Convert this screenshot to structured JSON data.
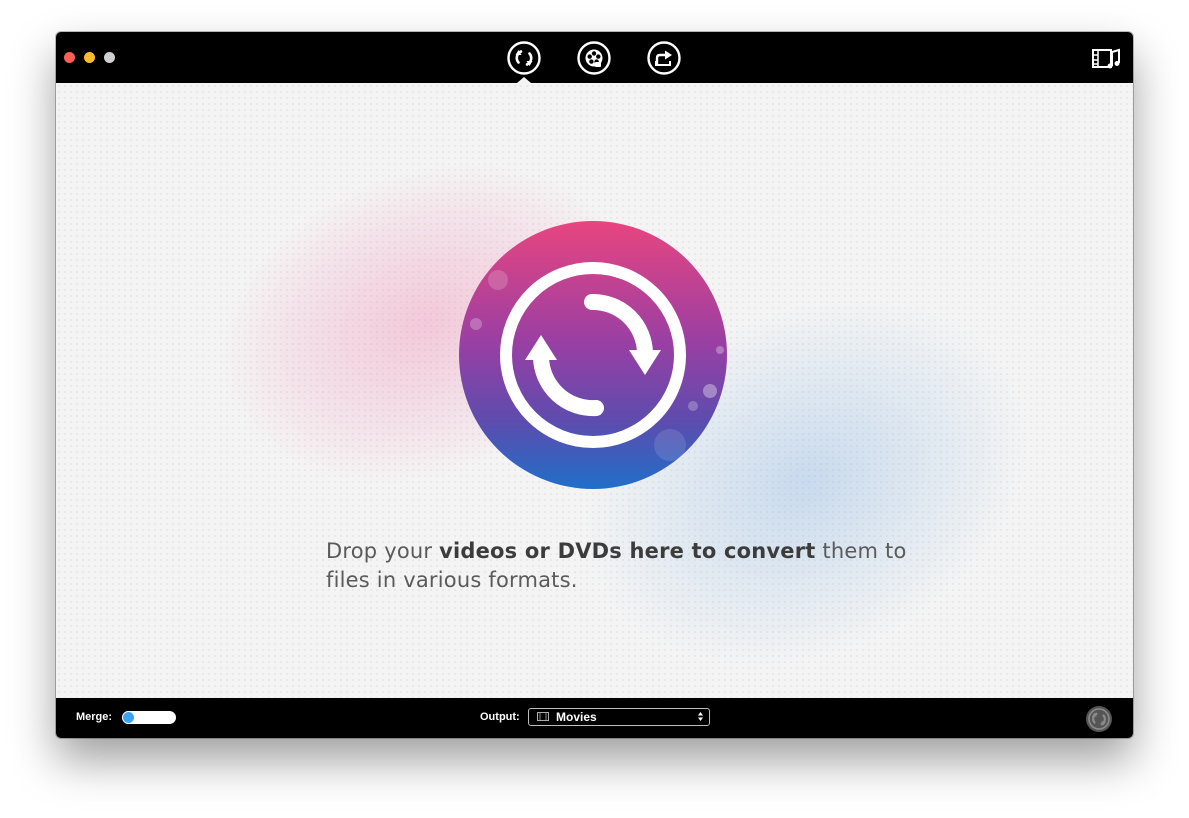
{
  "toolbar": {
    "tools": [
      {
        "name": "Convert",
        "icon": "convert-arrows-icon",
        "active": true
      },
      {
        "name": "Burn",
        "icon": "film-reel-icon",
        "active": false
      },
      {
        "name": "Share",
        "icon": "share-arrow-icon",
        "active": false
      }
    ],
    "media_browser_icon": "film-music-icon"
  },
  "main": {
    "drop_text_before": "Drop your ",
    "drop_text_bold": "videos or DVDs here to convert",
    "drop_text_after": " them to files in various formats.",
    "hero_icon": "convert-arrows-icon"
  },
  "bottombar": {
    "merge_label": "Merge:",
    "merge_enabled": false,
    "output_label": "Output:",
    "output_value": "Movies",
    "output_icon": "movies-folder-icon",
    "convert_button_icon": "convert-arrows-icon"
  },
  "colors": {
    "titlebar": "#000000",
    "content_background": "#f4f4f4",
    "hero_gradient_top": "#e8457f",
    "hero_gradient_mid": "#8f3fa6",
    "hero_gradient_bottom": "#1f6fc9",
    "toggle_knob": "#3aa3f4",
    "traffic_close": "#fc5f57",
    "traffic_minimize": "#fdbc2e",
    "traffic_zoom": "#cfcfcf"
  }
}
